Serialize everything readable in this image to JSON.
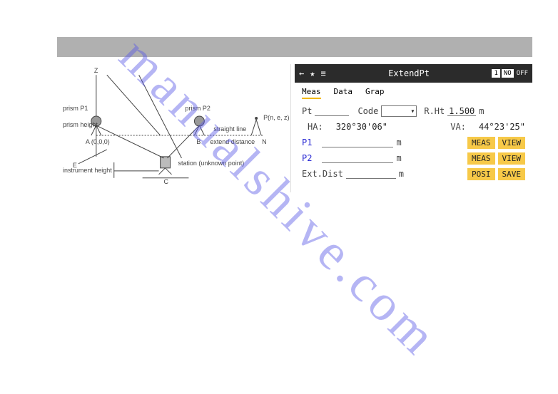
{
  "watermark": "manualshive.com",
  "diagram": {
    "axis_z": "Z",
    "axis_e": "E",
    "prism_p1": "prism P1",
    "prism_p2": "prism P2",
    "prism_height": "prism height",
    "point_a": "A (0,0,0)",
    "point_b": "B",
    "point_n": "N",
    "point_p": "P(n, e, z)",
    "straight_line": "straight line",
    "extend_distance": "extend distance",
    "instrument_height": "instrument height",
    "station": "station (unknown point)",
    "point_c": "C"
  },
  "app": {
    "titlebar": {
      "back": "←",
      "star": "★",
      "db": "≡",
      "title": "ExtendPt",
      "page": "1",
      "no": "NO",
      "off": "OFF"
    },
    "tabs": {
      "meas": "Meas",
      "data": "Data",
      "grap": "Grap"
    },
    "fields": {
      "pt_label": "Pt",
      "pt_value": "",
      "code_label": "Code",
      "code_value": "",
      "rht_label": "R.Ht",
      "rht_value": "1.500",
      "rht_unit": "m",
      "ha_label": "HA:",
      "ha_value": "320°30'06\"",
      "va_label": "VA:",
      "va_value": "44°23'25\"",
      "p1_label": "P1",
      "p1_value": "",
      "p1_unit": "m",
      "p2_label": "P2",
      "p2_value": "",
      "p2_unit": "m",
      "ext_label": "Ext.Dist",
      "ext_value": "",
      "ext_unit": "m"
    },
    "buttons": {
      "meas": "MEAS",
      "view": "VIEW",
      "posi": "POSI",
      "save": "SAVE"
    }
  }
}
